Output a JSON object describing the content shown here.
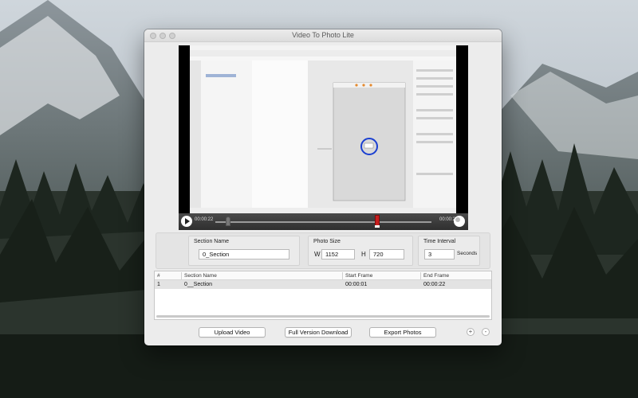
{
  "window": {
    "title": "Video To Photo Lite"
  },
  "player": {
    "current_time": "00:00:22",
    "end_time": "00:00:29",
    "playhead": 0.06,
    "end_marker": 0.75
  },
  "section": {
    "label": "Section Name",
    "value": "0_Section"
  },
  "photo_size": {
    "label": "Photo Size",
    "w_label": "W",
    "w_value": "1152",
    "h_label": "H",
    "h_value": "720"
  },
  "interval": {
    "label": "Time Interval",
    "value": "3",
    "unit": "Seconds"
  },
  "table": {
    "headers": {
      "num": "#",
      "section": "Section Name",
      "start": "Start Frame",
      "end": "End Frame"
    },
    "rows": [
      {
        "num": "1",
        "section": "0__Section",
        "start": "00:00:01",
        "end": "00:00:22"
      }
    ]
  },
  "buttons": {
    "upload": "Upload Video",
    "full": "Full Version Download",
    "export": "Export Photos",
    "add": "+",
    "remove": "-"
  },
  "colors": {
    "accent_red": "#c81e1e",
    "circle_blue": "#1a3fd1"
  }
}
